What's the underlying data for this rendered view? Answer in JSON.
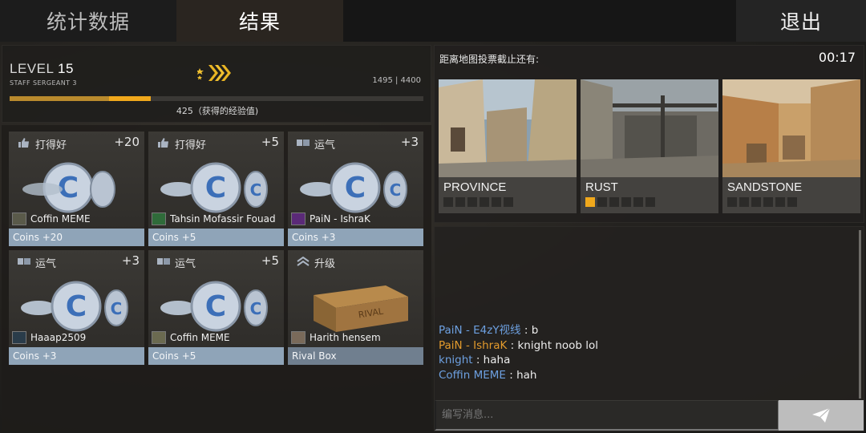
{
  "tabs": {
    "stats": "统计数据",
    "results": "结果",
    "exit": "退出"
  },
  "level": {
    "label": "LEVEL",
    "number": "15",
    "rank": "STAFF SERGEANT 3",
    "xp_progress": "1495 | 4400",
    "xp_fraction": 0.34,
    "xp_gained_fraction": 0.1,
    "xp_gained": "425（获得的经验值)"
  },
  "rewards": [
    {
      "type": "打得好",
      "amount": "+20",
      "player": "Coffin MEME",
      "item": "Coins +20",
      "icon": "thumbs-up-icon"
    },
    {
      "type": "打得好",
      "amount": "+5",
      "player": "Tahsin Mofassir Fouad",
      "item": "Coins +5",
      "icon": "thumbs-up-icon"
    },
    {
      "type": "运气",
      "amount": "+3",
      "player": "PaiN - IshraK",
      "item": "Coins +3",
      "icon": "dice-icon"
    },
    {
      "type": "运气",
      "amount": "+3",
      "player": "Haaap2509",
      "item": "Coins +3",
      "icon": "dice-icon"
    },
    {
      "type": "运气",
      "amount": "+5",
      "player": "Coffin MEME",
      "item": "Coins +5",
      "icon": "dice-icon"
    },
    {
      "type": "升级",
      "amount": "",
      "player": "Harith hensem",
      "item": "Rival Box",
      "icon": "chevron-up-icon"
    }
  ],
  "vote": {
    "title": "距离地图投票截止还有:",
    "timer": "00:17",
    "maps": [
      {
        "name": "PROVINCE",
        "votes": 0
      },
      {
        "name": "RUST",
        "votes": 1
      },
      {
        "name": "SANDSTONE",
        "votes": 0
      }
    ]
  },
  "chat": {
    "messages": [
      {
        "name": "PaiN - E4zY视线",
        "text": " : b",
        "color": "blue"
      },
      {
        "name": "PaiN - IshraK",
        "text": " : knight noob lol",
        "color": "orange"
      },
      {
        "name": "knight",
        "text": " : haha",
        "color": "blue"
      },
      {
        "name": "Coffin MEME",
        "text": " : hah",
        "color": "blue"
      }
    ],
    "placeholder": "编写消息..."
  },
  "colors": {
    "accent": "#f0a81c",
    "blue_name": "#6da0e0",
    "orange_name": "#e29a2c",
    "coin_bar": "#8fa4b8"
  }
}
